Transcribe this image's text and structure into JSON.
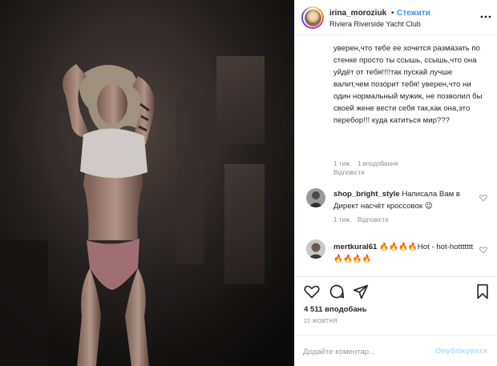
{
  "header": {
    "username": "irina_moroziuk",
    "dot": "•",
    "follow_label": "Стежити",
    "location": "Riviera Riverside Yacht Club",
    "avatar_icon": "profile-avatar",
    "more_icon": "more-options-icon"
  },
  "comments": {
    "continued_text": "уверен,что тебе ее хочется размазать по стенке просто ты ссышь, ссышь,что она уйдёт от тебя!!!!так пускай лучше валит,чем позорит тебя! уверен,что ни один нормальный мужик, не позволил бы своей жене вести себя так,как она,это перебор!!! куда катиться мир???",
    "continued_time": "1 тиж.",
    "continued_likes": "1 вподобання",
    "continued_reply": "Відповісти",
    "items": [
      {
        "username": "shop_bright_style",
        "text": "Написала Вам в Директ насчёт кроссовок 😉",
        "time": "1 тиж.",
        "reply": "Відповісти"
      },
      {
        "username": "mertkural61",
        "text": "🔥🔥🔥🔥Hot - hot-hottttttt🔥🔥🔥🔥",
        "time": "",
        "reply": ""
      }
    ]
  },
  "actions": {
    "like_icon": "heart-icon",
    "comment_icon": "comment-icon",
    "share_icon": "share-icon",
    "save_icon": "bookmark-icon",
    "likes_count": "4 511 вподобань",
    "date": "22 ЖОВТНЯ"
  },
  "add_comment": {
    "placeholder": "Додайте коментар...",
    "publish_label": "Опублікувати"
  },
  "colors": {
    "link_blue": "#3897f0",
    "publish_disabled": "#b2dffc",
    "muted_text": "#8e8e8e",
    "border": "#efefef"
  }
}
